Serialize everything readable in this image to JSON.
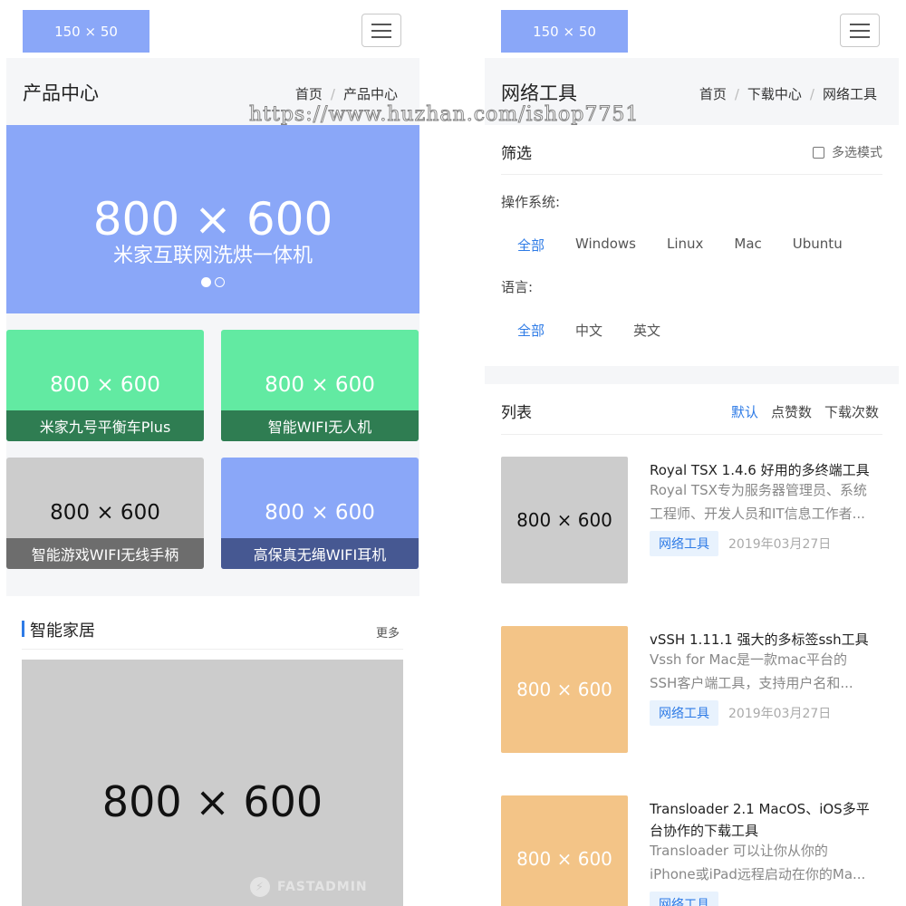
{
  "left": {
    "logo": "150 × 50",
    "page_title": "产品中心",
    "breadcrumb": [
      "首页",
      "产品中心"
    ],
    "banner": {
      "size_text": "800 × 600",
      "caption": "米家互联网洗烘一体机",
      "slides": 2,
      "active_slide": 0,
      "color": "#8aa7f8"
    },
    "products": [
      {
        "size_text": "800 × 600",
        "caption": "米家九号平衡车Plus",
        "color": "#62eaa2",
        "caption_bg": "#2f7d52"
      },
      {
        "size_text": "800 × 600",
        "caption": "智能WIFI无人机",
        "color": "#62eaa2",
        "caption_bg": "#2f7d52"
      },
      {
        "size_text": "800 × 600",
        "caption": "智能游戏WIFI无线手柄",
        "color": "#cccccc",
        "caption_bg": "#6d6d6d"
      },
      {
        "size_text": "800 × 600",
        "caption": "高保真无绳WIFI耳机",
        "color": "#8aa7f8",
        "caption_bg": "#465892"
      }
    ],
    "section": {
      "title": "智能家居",
      "more": "更多",
      "image_size_text": "800 × 600",
      "image_watermark": "FASTADMIN"
    }
  },
  "right": {
    "logo": "150 × 50",
    "page_title": "网络工具",
    "breadcrumb": [
      "首页",
      "下载中心",
      "网络工具"
    ],
    "filter": {
      "title": "筛选",
      "multi_label": "多选模式",
      "multi_checked": false,
      "os_label": "操作系统:",
      "os_options": [
        "全部",
        "Windows",
        "Linux",
        "Mac",
        "Ubuntu"
      ],
      "os_active": 0,
      "lang_label": "语言:",
      "lang_options": [
        "全部",
        "中文",
        "英文"
      ],
      "lang_active": 0
    },
    "list": {
      "title": "列表",
      "sorts": [
        "默认",
        "点赞数",
        "下载次数"
      ],
      "sort_active": 0,
      "items": [
        {
          "thumb_text": "800 × 600",
          "thumb_color": "#cccccc",
          "title": "Royal TSX 1.4.6 好用的多终端工具",
          "desc": [
            "Royal TSX专为服务器管理员、系统",
            "工程师、开发人员和IT信息工作者..."
          ],
          "tag": "网络工具",
          "date": "2019年03月27日"
        },
        {
          "thumb_text": "800 × 600",
          "thumb_color": "#f3c487",
          "title": "vSSH 1.11.1 强大的多标签ssh工具",
          "desc": [
            "Vssh for Mac是一款mac平台的",
            "SSH客户端工具，支持用户名和..."
          ],
          "tag": "网络工具",
          "date": "2019年03月27日"
        },
        {
          "thumb_text": "800 × 600",
          "thumb_color": "#f3c487",
          "title": "Transloader 2.1 MacOS、iOS多平台协作的下载工具",
          "desc": [
            "Transloader 可以让你从你的",
            "iPhone或iPad远程启动在你的Ma..."
          ],
          "tag": "网络工具",
          "date": ""
        }
      ]
    }
  },
  "watermark": "https://www.huzhan.com/ishop7751",
  "colors": {
    "accent": "#2e7be6",
    "placeholder_blue": "#8aa7f8",
    "placeholder_green": "#62eaa2",
    "placeholder_gray": "#cccccc",
    "placeholder_orange": "#f3c487"
  }
}
